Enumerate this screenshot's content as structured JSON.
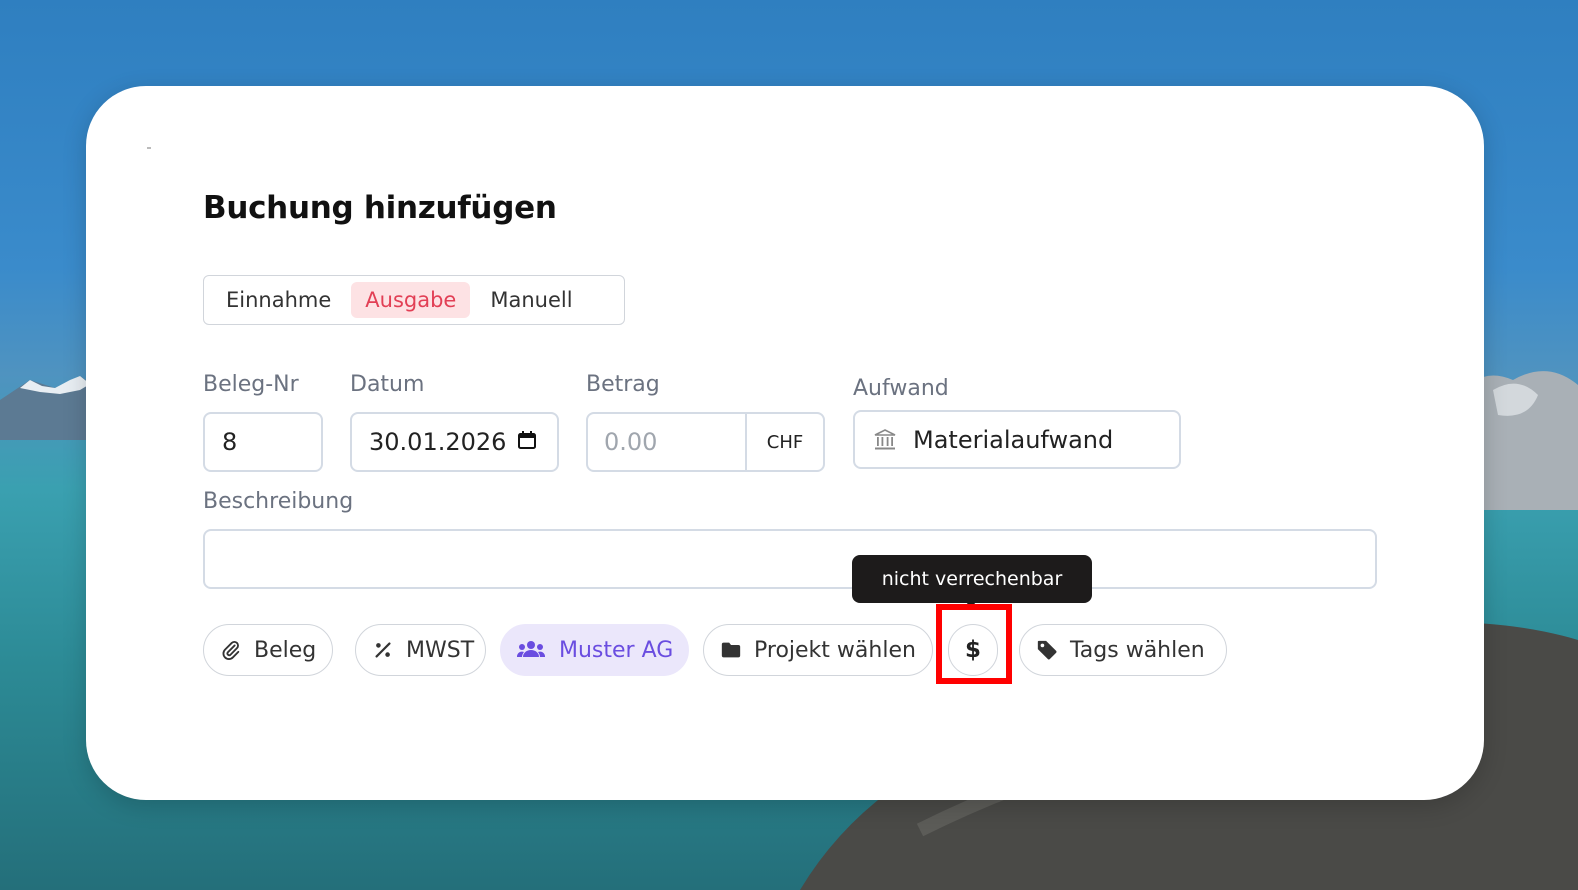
{
  "dialog": {
    "title": "Buchung hinzufügen",
    "type_tabs": [
      {
        "label": "Einnahme",
        "active": false
      },
      {
        "label": "Ausgabe",
        "active": true
      },
      {
        "label": "Manuell",
        "active": false
      }
    ],
    "fields": {
      "beleg_nr": {
        "label": "Beleg-Nr",
        "value": "8"
      },
      "datum": {
        "label": "Datum",
        "value": "30.01.2026",
        "icon": "calendar-icon"
      },
      "betrag": {
        "label": "Betrag",
        "placeholder": "0.00",
        "currency": "CHF"
      },
      "aufwand": {
        "label": "Aufwand",
        "value": "Materialaufwand",
        "icon": "bank-icon"
      },
      "beschreibung": {
        "label": "Beschreibung",
        "value": ""
      }
    },
    "chips": {
      "beleg": {
        "label": "Beleg",
        "icon": "paperclip-icon"
      },
      "mwst": {
        "label": "MWST",
        "icon": "percent-icon"
      },
      "kunde": {
        "label": "Muster AG",
        "icon": "users-icon"
      },
      "projekt": {
        "label": "Projekt wählen",
        "icon": "folder-icon"
      },
      "verrechenbar": {
        "icon": "dollar-icon",
        "tooltip": "nicht verrechenbar"
      },
      "tags": {
        "label": "Tags wählen",
        "icon": "tag-icon"
      }
    }
  },
  "colors": {
    "active_tab_bg": "#fde2e4",
    "active_tab_text": "#e23f55",
    "client_chip_bg": "#ebe7fb",
    "client_chip_text": "#6a4de0",
    "tooltip_bg": "#1d1b1b",
    "highlight": "#ff0000"
  }
}
